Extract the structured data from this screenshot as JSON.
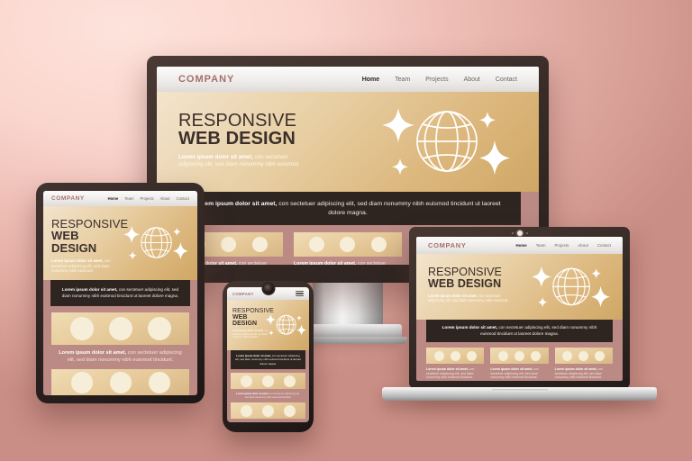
{
  "brand": {
    "logo": "COMPANY"
  },
  "nav": {
    "items": [
      "Home",
      "Team",
      "Projects",
      "About",
      "Contact"
    ],
    "active": "Home"
  },
  "hero": {
    "title_line1": "RESPONSIVE",
    "title_line2": "WEB DESIGN",
    "subtitle_bold": "Lorem ipsum dolor sit amet,",
    "subtitle_rest": " con sectetuer adipiscing elit, sed diam nonummy nibh euismod.",
    "art": {
      "globe": "globe-icon",
      "sparkles": 4
    }
  },
  "band": {
    "bold": "Lorem ipsum dolor sit amet,",
    "rest": " con sectetuer adipiscing elit, sed diam nonummy nibh euismod tincidunt ut laoreet dolore magna."
  },
  "cards": [
    {
      "dots": 3,
      "text_bold": "Lorem ipsum dolor sit amet,",
      "text_rest": " con sectetuer adipiscing elit, sed diam nonummy nibh euismod tincidunt."
    },
    {
      "dots": 3,
      "text_bold": "Lorem ipsum dolor sit amet,",
      "text_rest": " con sectetuer adipiscing elit, sed diam nonummy nibh euismod tincidunt."
    },
    {
      "dots": 3,
      "text_bold": "Lorem ipsum dolor sit amet,",
      "text_rest": " con sectetuer adipiscing elit, sed diam nonummy nibh euismod tincidunt."
    }
  ],
  "devices": {
    "monitor": {
      "name": "desktop-monitor"
    },
    "tablet": {
      "name": "tablet"
    },
    "phone": {
      "name": "smartphone",
      "menu_icon": "hamburger-menu-icon"
    },
    "laptop": {
      "name": "laptop"
    }
  },
  "colors": {
    "background_light": "#fde3dc",
    "background_dark": "#c98e85",
    "logo": "#a4706c",
    "hero_gold": "#dcb77d",
    "band_dark": "#2e2520",
    "page_rose": "#bb8a84",
    "card_dot": "#f7eeda"
  }
}
